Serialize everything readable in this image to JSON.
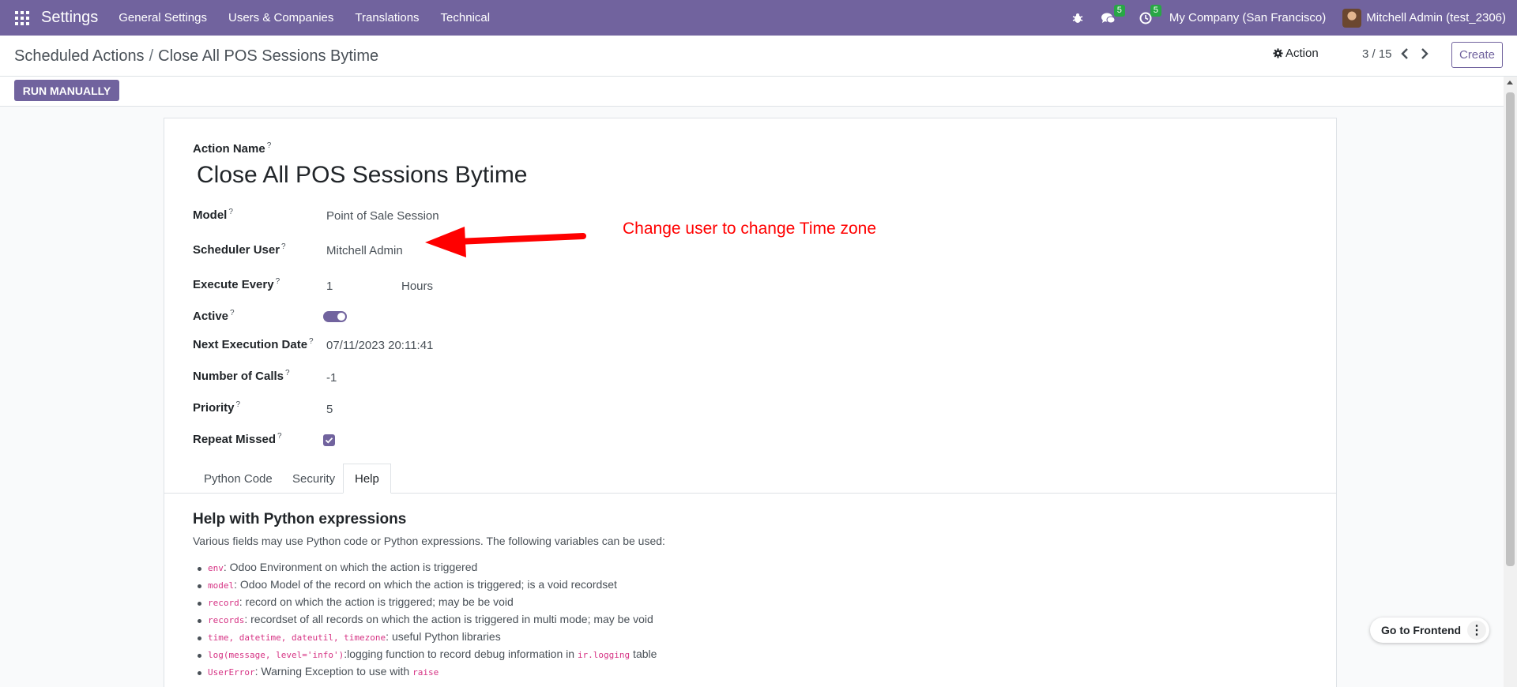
{
  "navbar": {
    "app_name": "Settings",
    "menus": [
      "General Settings",
      "Users & Companies",
      "Translations",
      "Technical"
    ],
    "messages_count": "5",
    "activities_count": "5",
    "company": "My Company (San Francisco)",
    "user": "Mitchell Admin (test_2306)"
  },
  "control_panel": {
    "breadcrumb_parent": "Scheduled Actions",
    "breadcrumb_separator": "/",
    "breadcrumb_current": "Close All POS Sessions Bytime",
    "action_label": "Action",
    "pager": "3 / 15",
    "create_label": "Create"
  },
  "statusbar": {
    "run_label": "RUN MANUALLY"
  },
  "form": {
    "action_name_label": "Action Name",
    "action_name": "Close All POS Sessions Bytime",
    "model_label": "Model",
    "model": "Point of Sale Session",
    "scheduler_user_label": "Scheduler User",
    "scheduler_user": "Mitchell Admin",
    "execute_every_label": "Execute Every",
    "execute_every_value": "1",
    "execute_every_unit": "Hours",
    "active_label": "Active",
    "active": true,
    "next_execution_label": "Next Execution Date",
    "next_execution": "07/11/2023 20:11:41",
    "number_of_calls_label": "Number of Calls",
    "number_of_calls": "-1",
    "priority_label": "Priority",
    "priority": "5",
    "repeat_missed_label": "Repeat Missed",
    "repeat_missed": true,
    "help_mark": "?"
  },
  "tabs": [
    "Python Code",
    "Security",
    "Help"
  ],
  "active_tab": "Help",
  "help": {
    "title": "Help with Python expressions",
    "intro": "Various fields may use Python code or Python expressions. The following variables can be used:",
    "items": [
      {
        "code": "env",
        "text": ": Odoo Environment on which the action is triggered"
      },
      {
        "code": "model",
        "text": ": Odoo Model of the record on which the action is triggered; is a void recordset"
      },
      {
        "code": "record",
        "text": ": record on which the action is triggered; may be be void"
      },
      {
        "code": "records",
        "text": ": recordset of all records on which the action is triggered in multi mode; may be void"
      },
      {
        "code": "time, datetime, dateutil, timezone",
        "text": ": useful Python libraries"
      },
      {
        "code": "log(message, level='info')",
        "text": ":logging function to record debug information in ",
        "code2": "ir.logging",
        "text2": " table"
      },
      {
        "code": "UserError",
        "text": ": Warning Exception to use with ",
        "code2": "raise"
      }
    ]
  },
  "annotation": {
    "text": "Change user to change Time zone",
    "color": "#ff0000"
  },
  "floating": {
    "frontend_label": "Go to Frontend",
    "more_label": "⋮"
  },
  "colors": {
    "brand": "#71639e",
    "badge": "#28a745",
    "annotation": "#ff0000"
  }
}
